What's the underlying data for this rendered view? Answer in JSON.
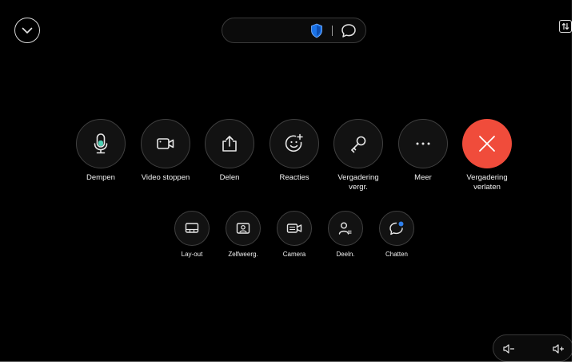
{
  "controls": {
    "mute": "Dempen",
    "video": "Video stoppen",
    "share": "Delen",
    "reactions": "Reacties",
    "lock": "Vergadering vergr.",
    "more": "Meer",
    "leave": "Vergadering verlaten"
  },
  "secondary": {
    "layout": "Lay-out",
    "selfview": "Zelfweerg.",
    "camera": "Camera",
    "participants": "Deeln.",
    "chat": "Chatten"
  },
  "colors": {
    "background": "#000000",
    "leave_button": "#f04c3b",
    "shield": "#1a73e8",
    "mic_level": "#4fd1b5",
    "chat_badge": "#2f80ed"
  }
}
